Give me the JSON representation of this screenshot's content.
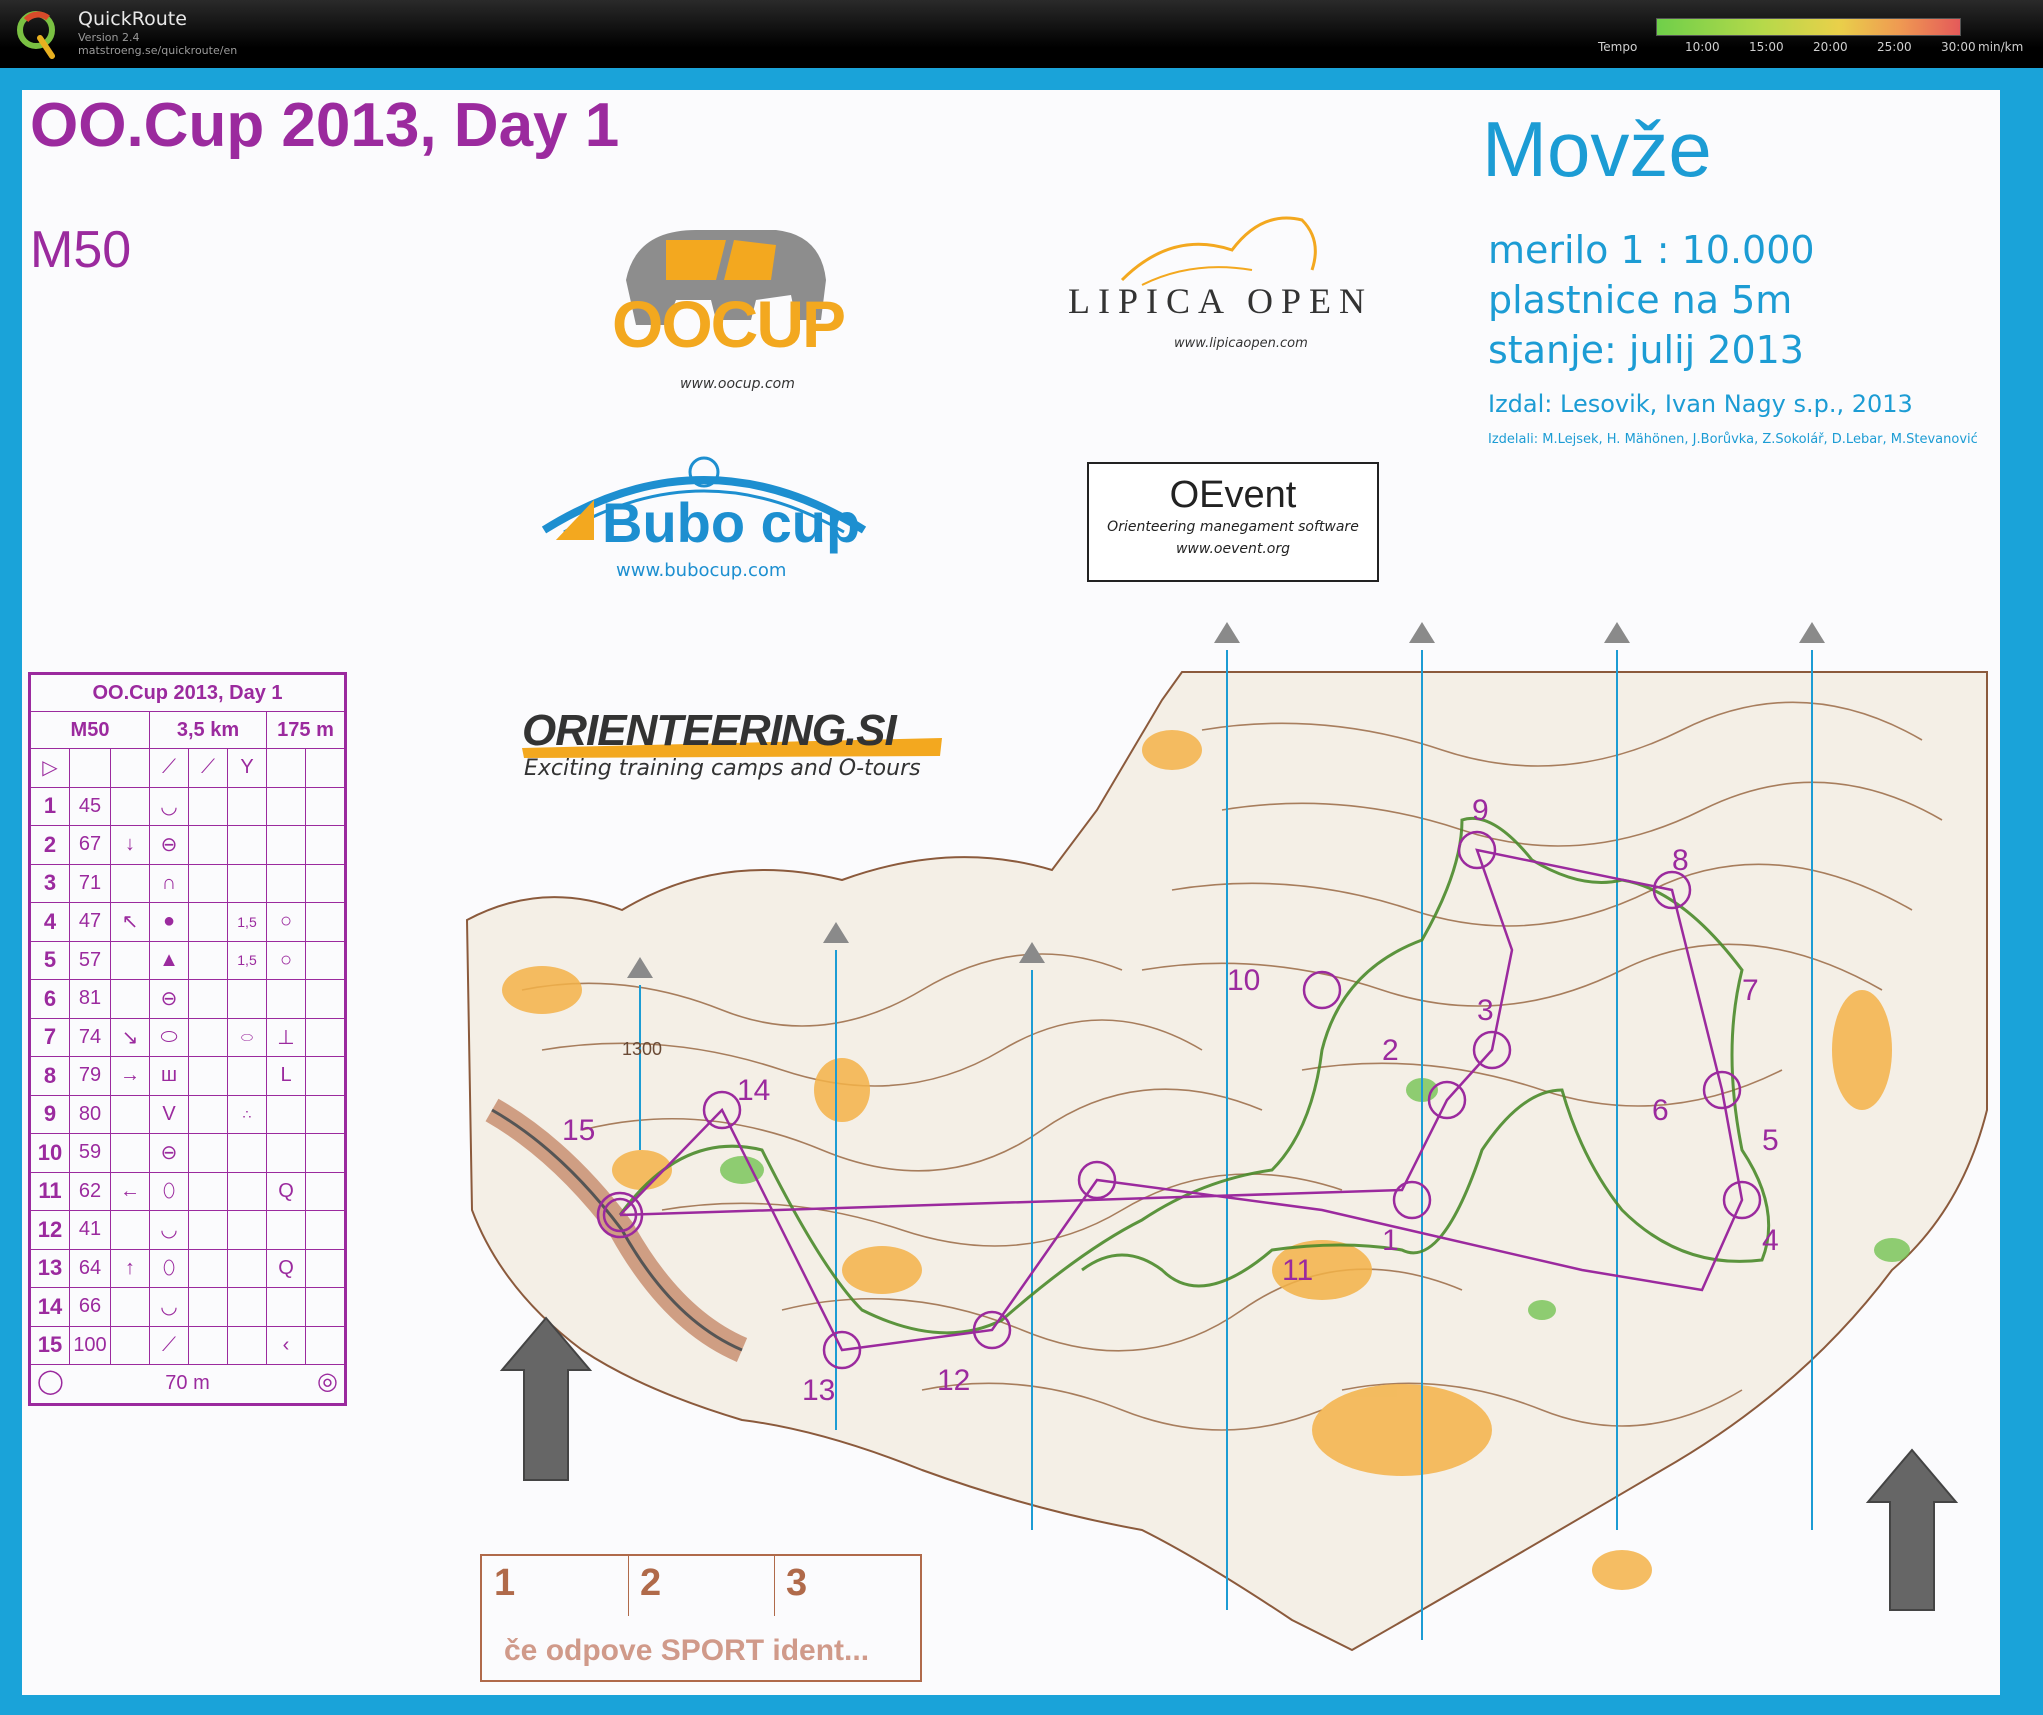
{
  "app": {
    "name": "QuickRoute",
    "version": "Version 2.4",
    "url": "matstroeng.se/quickroute/en",
    "tempo_label": "Tempo",
    "tempo_ticks": [
      "10:00",
      "15:00",
      "20:00",
      "25:00",
      "30:00"
    ],
    "tempo_unit": "min/km"
  },
  "map": {
    "event_title": "OO.Cup 2013, Day 1",
    "category": "M50",
    "map_name": "Movže",
    "scale": "merilo 1 : 10.000",
    "contour": "plastnice na 5m",
    "state": "stanje: julij 2013",
    "publisher": "Izdal: Lesovik, Ivan Nagy s.p., 2013",
    "authors": "Izdelali: M.Lejsek, H. Mähönen, J.Borůvka, Z.Sokolář, D.Lebar, M.Stevanović",
    "height_label": "1300",
    "colors": {
      "course": "#9b2a9e",
      "water": "#1c9cd4",
      "route": "#4a8a2a",
      "open": "#f3a81f"
    }
  },
  "sponsors": {
    "oocup_name": "OOCUP",
    "oocup_url": "www.oocup.com",
    "lipica_name": "LIPICA OPEN",
    "lipica_url": "www.lipicaopen.com",
    "bubo_name": "Bubo cup",
    "bubo_url": "www.bubocup.com",
    "oevent_name": "OEvent",
    "oevent_tagline": "Orienteering manegament software",
    "oevent_url": "www.oevent.org",
    "osi_name": "ORIENTEERING.SI",
    "osi_tagline": "Exciting training camps and O-tours"
  },
  "description": {
    "title": "OO.Cup 2013, Day 1",
    "category": "M50",
    "length": "3,5 km",
    "climb": "175 m",
    "finish_distance": "70 m",
    "controls": [
      {
        "n": "1",
        "code": "45",
        "dir": "",
        "feat": "◡",
        "dim": "",
        "extra": ""
      },
      {
        "n": "2",
        "code": "67",
        "dir": "↓",
        "feat": "⊖",
        "dim": "",
        "extra": ""
      },
      {
        "n": "3",
        "code": "71",
        "dir": "",
        "feat": "∩",
        "dim": "",
        "extra": ""
      },
      {
        "n": "4",
        "code": "47",
        "dir": "↖",
        "feat": "●",
        "dim": "1,5",
        "extra": "○"
      },
      {
        "n": "5",
        "code": "57",
        "dir": "",
        "feat": "▲",
        "dim": "1,5",
        "extra": "○"
      },
      {
        "n": "6",
        "code": "81",
        "dir": "",
        "feat": "⊖",
        "dim": "",
        "extra": ""
      },
      {
        "n": "7",
        "code": "74",
        "dir": "↘",
        "feat": "⬭",
        "dim": "⬭",
        "extra": "⊥"
      },
      {
        "n": "8",
        "code": "79",
        "dir": "→",
        "feat": "ш",
        "dim": "",
        "extra": "L"
      },
      {
        "n": "9",
        "code": "80",
        "dir": "",
        "feat": "V",
        "dim": "∴",
        "extra": ""
      },
      {
        "n": "10",
        "code": "59",
        "dir": "",
        "feat": "⊖",
        "dim": "",
        "extra": ""
      },
      {
        "n": "11",
        "code": "62",
        "dir": "←",
        "feat": "⬯",
        "dim": "",
        "extra": "Q"
      },
      {
        "n": "12",
        "code": "41",
        "dir": "",
        "feat": "◡",
        "dim": "",
        "extra": ""
      },
      {
        "n": "13",
        "code": "64",
        "dir": "↑",
        "feat": "⬯",
        "dim": "",
        "extra": "Q"
      },
      {
        "n": "14",
        "code": "66",
        "dir": "",
        "feat": "◡",
        "dim": "",
        "extra": ""
      },
      {
        "n": "15",
        "code": "100",
        "dir": "",
        "feat": "⟋",
        "dim": "",
        "extra": "‹"
      }
    ]
  },
  "course_labels": [
    "1",
    "2",
    "3",
    "4",
    "5",
    "6",
    "7",
    "8",
    "9",
    "10",
    "11",
    "12",
    "13",
    "14",
    "15"
  ],
  "sportident": {
    "cells": [
      "1",
      "2",
      "3"
    ],
    "note": "če odpove SPORT ident..."
  }
}
